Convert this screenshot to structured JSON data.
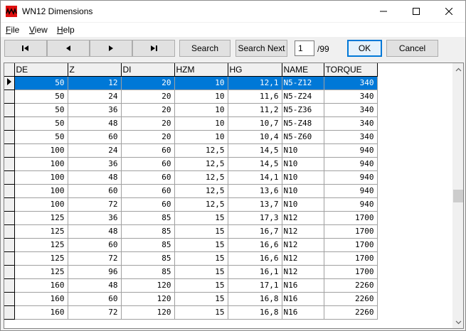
{
  "window": {
    "title": "WN12 Dimensions",
    "icon": "app-logo-icon",
    "controls": [
      "minimize-icon",
      "maximize-icon",
      "close-icon"
    ]
  },
  "menu": {
    "file": {
      "accel": "F",
      "rest": "ile"
    },
    "view": {
      "accel": "V",
      "rest": "iew"
    },
    "help": {
      "accel": "H",
      "rest": "elp"
    }
  },
  "toolbar": {
    "first_icon": "first-record-icon",
    "prev_icon": "previous-record-icon",
    "next_icon": "next-record-icon",
    "last_icon": "last-record-icon",
    "search_label": "Search",
    "search_next_label": "Search Next",
    "page_value": "1",
    "page_total": "/99",
    "ok_label": "OK",
    "cancel_label": "Cancel"
  },
  "grid": {
    "columns": [
      "DE",
      "Z",
      "DI",
      "HZM",
      "HG",
      "NAME",
      "TORQUE"
    ],
    "selected_row": 0,
    "rows": [
      [
        "50",
        "12",
        "20",
        "10",
        "12,1",
        "N5-Z12",
        "340"
      ],
      [
        "50",
        "24",
        "20",
        "10",
        "11,6",
        "N5-Z24",
        "340"
      ],
      [
        "50",
        "36",
        "20",
        "10",
        "11,2",
        "N5-Z36",
        "340"
      ],
      [
        "50",
        "48",
        "20",
        "10",
        "10,7",
        "N5-Z48",
        "340"
      ],
      [
        "50",
        "60",
        "20",
        "10",
        "10,4",
        "N5-Z60",
        "340"
      ],
      [
        "100",
        "24",
        "60",
        "12,5",
        "14,5",
        "N10",
        "940"
      ],
      [
        "100",
        "36",
        "60",
        "12,5",
        "14,5",
        "N10",
        "940"
      ],
      [
        "100",
        "48",
        "60",
        "12,5",
        "14,1",
        "N10",
        "940"
      ],
      [
        "100",
        "60",
        "60",
        "12,5",
        "13,6",
        "N10",
        "940"
      ],
      [
        "100",
        "72",
        "60",
        "12,5",
        "13,7",
        "N10",
        "940"
      ],
      [
        "125",
        "36",
        "85",
        "15",
        "17,3",
        "N12",
        "1700"
      ],
      [
        "125",
        "48",
        "85",
        "15",
        "16,7",
        "N12",
        "1700"
      ],
      [
        "125",
        "60",
        "85",
        "15",
        "16,6",
        "N12",
        "1700"
      ],
      [
        "125",
        "72",
        "85",
        "15",
        "16,6",
        "N12",
        "1700"
      ],
      [
        "125",
        "96",
        "85",
        "15",
        "16,1",
        "N12",
        "1700"
      ],
      [
        "160",
        "48",
        "120",
        "15",
        "17,1",
        "N16",
        "2260"
      ],
      [
        "160",
        "60",
        "120",
        "15",
        "16,8",
        "N16",
        "2260"
      ],
      [
        "160",
        "72",
        "120",
        "15",
        "16,8",
        "N16",
        "2260"
      ]
    ]
  },
  "colors": {
    "selection": "#0078d7",
    "logo": "#e01010"
  }
}
